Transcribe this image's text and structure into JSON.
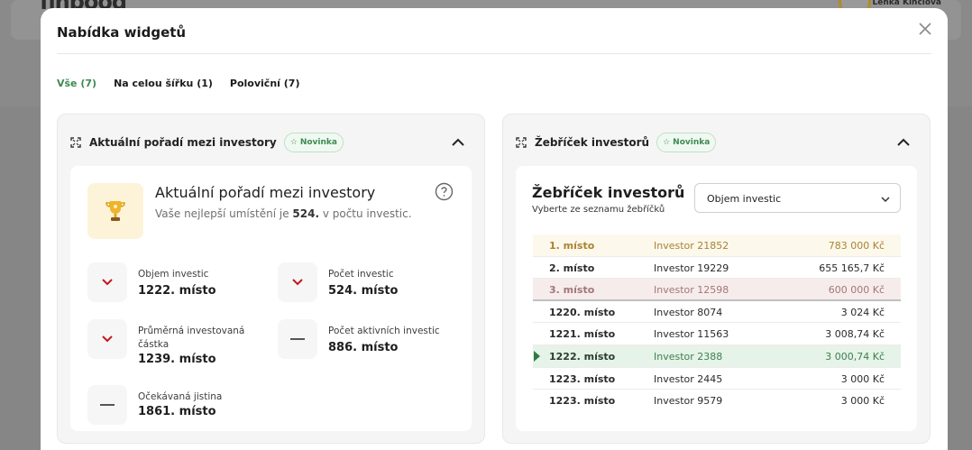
{
  "background": {
    "logo": "finpood",
    "user_name": "Lenka Kinclová"
  },
  "modal": {
    "title": "Nabídka widgetů",
    "tabs": [
      {
        "label": "Vše (7)",
        "active": true
      },
      {
        "label": "Na celou šířku (1)",
        "active": false
      },
      {
        "label": "Poloviční (7)",
        "active": false
      }
    ]
  },
  "left_card": {
    "title": "Aktuální pořadí mezi investory",
    "badge": "Novinka",
    "inner_title": "Aktuální pořadí mezi investory",
    "subtitle_prefix": "Vaše nejlepší umístění je ",
    "subtitle_rank": "524.",
    "subtitle_suffix": " v počtu investic.",
    "stats": [
      {
        "label": "Objem investic",
        "value": "1222. místo",
        "trend": "down"
      },
      {
        "label": "Počet investic",
        "value": "524. místo",
        "trend": "down"
      },
      {
        "label": "Průměrná investovaná částka",
        "value": "1239. místo",
        "trend": "down"
      },
      {
        "label": "Počet aktivních investic",
        "value": "886. místo",
        "trend": "flat"
      },
      {
        "label": "Očekávaná jistina",
        "value": "1861. místo",
        "trend": "flat"
      }
    ]
  },
  "right_card": {
    "title": "Žebříček investorů",
    "badge": "Novinka",
    "inner_title": "Žebříček investorů",
    "inner_subtitle": "Vyberte ze seznamu žebříčků",
    "select_value": "Objem investic",
    "rows": [
      {
        "rank": "1. místo",
        "investor": "Investor 21852",
        "amount": "783 000 Kč",
        "style": "gold"
      },
      {
        "rank": "2. místo",
        "investor": "Investor 19229",
        "amount": "655 165,7 Kč",
        "style": "plain"
      },
      {
        "rank": "3. místo",
        "investor": "Investor 12598",
        "amount": "600 000 Kč",
        "style": "pink"
      },
      {
        "rank": "1220. místo",
        "investor": "Investor 8074",
        "amount": "3 024 Kč",
        "style": "plain"
      },
      {
        "rank": "1221. místo",
        "investor": "Investor 11563",
        "amount": "3 008,74 Kč",
        "style": "plain"
      },
      {
        "rank": "1222. místo",
        "investor": "Investor 2388",
        "amount": "3 000,74 Kč",
        "style": "green"
      },
      {
        "rank": "1223. místo",
        "investor": "Investor 2445",
        "amount": "3 000 Kč",
        "style": "plain"
      },
      {
        "rank": "1223. místo",
        "investor": "Investor 9579",
        "amount": "3 000 Kč",
        "style": "plain"
      }
    ]
  },
  "colors": {
    "accent_green": "#3d8a52",
    "gold": "#a8842f",
    "trend_down": "#c4161c"
  }
}
